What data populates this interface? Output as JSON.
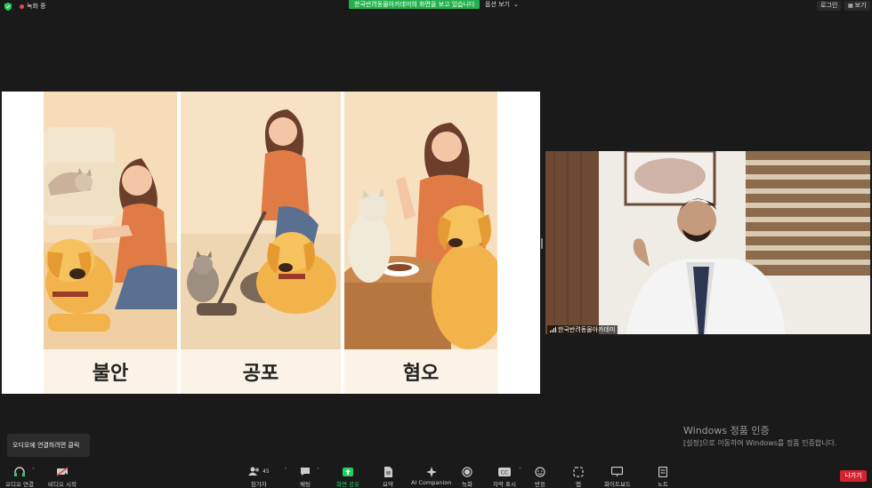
{
  "topbar": {
    "recording_label": "녹화 중",
    "share_banner": "한국반려동물아카데미의 화면을 보고 있습니다",
    "view_options_label": "옵션 보기",
    "login_label": "로그인",
    "view_label": "보기"
  },
  "slide": {
    "captions": [
      "불안",
      "공포",
      "혐오"
    ]
  },
  "camera": {
    "participant_name": "한국반려동물아카데미"
  },
  "windows_watermark": {
    "title": "Windows 정품 인증",
    "subtitle": "[설정]으로 이동하여 Windows를 정품 인증합니다."
  },
  "tooltip": {
    "text": "오디오에 연결하려면 클릭"
  },
  "toolbar": {
    "audio_label": "오디오 연결",
    "video_label": "비디오 시작",
    "participants_label": "참가자",
    "participants_count": "45",
    "chat_label": "채팅",
    "share_label": "화면 공유",
    "summary_label": "요약",
    "ai_label": "AI Companion",
    "record_label": "녹화",
    "cc_label": "자막 표시",
    "reactions_label": "반응",
    "apps_label": "앱",
    "whiteboard_label": "화이트보드",
    "notes_label": "노트",
    "leave_label": "나가기"
  },
  "colors": {
    "share_green": "#23b14d",
    "leave_red": "#d1242f",
    "background": "#1a1a1a"
  }
}
